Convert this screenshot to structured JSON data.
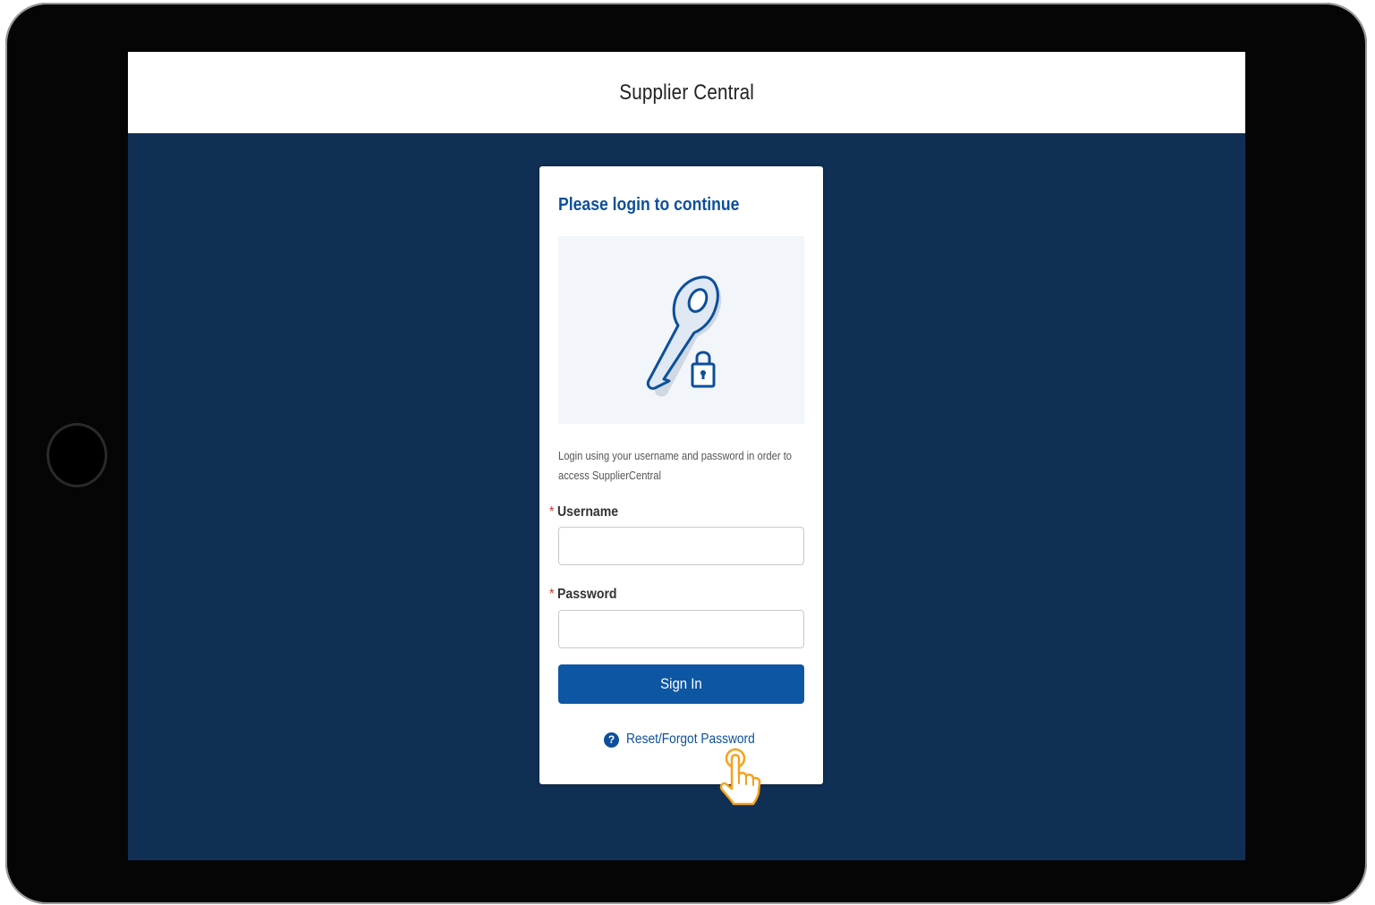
{
  "app": {
    "title": "Supplier Central"
  },
  "login_card": {
    "heading": "Please login to continue",
    "illustration_icon": "key-lock-icon",
    "help_text": "Login using your username and password in order to access SupplierCentral",
    "username": {
      "required_mark": "*",
      "label": "Username",
      "value": "",
      "placeholder": ""
    },
    "password": {
      "required_mark": "*",
      "label": "Password",
      "value": "",
      "placeholder": ""
    },
    "sign_in_label": "Sign In",
    "reset_link_icon": "question-circle-icon",
    "reset_link_label": "Reset/Forgot Password"
  },
  "overlay": {
    "cursor_icon": "hand-pointer-icon"
  },
  "colors": {
    "page_background": "#102f55",
    "heading": "#0d4f9a",
    "primary_button": "#0d56a3",
    "required": "#c23934",
    "cursor": "#f5a21b"
  }
}
